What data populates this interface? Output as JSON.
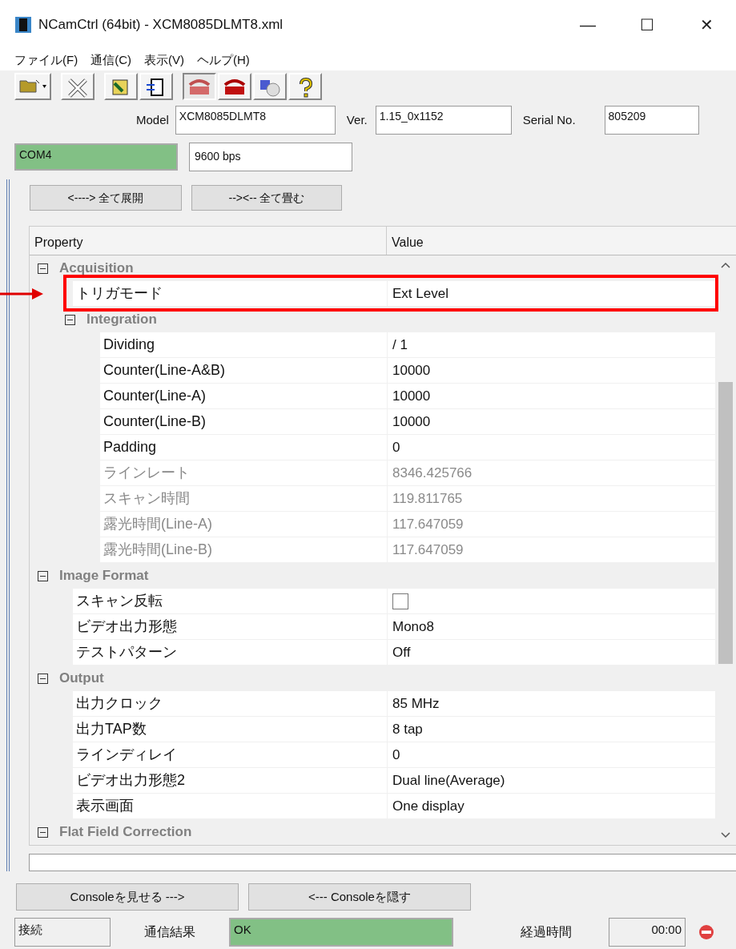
{
  "window": {
    "title": "NCamCtrl (64bit) - XCM8085DLMT8.xml",
    "controls": [
      "—",
      "☐",
      "✕"
    ]
  },
  "menu": [
    "ファイル(F)",
    "通信(C)",
    "表示(V)",
    "ヘルプ(H)"
  ],
  "toolbar": [
    {
      "pressed": false
    },
    {
      "pressed": false
    },
    {
      "pressed": false
    },
    {
      "pressed": false
    },
    {
      "pressed": true
    },
    {
      "pressed": false
    },
    {
      "pressed": false
    },
    {
      "pressed": false
    }
  ],
  "info": [
    {
      "label": "Model",
      "value": "XCM8085DLMT8"
    },
    {
      "label": "Ver.",
      "value": "1.15_0x1152"
    },
    {
      "label": "Serial No.",
      "value": "805209"
    }
  ],
  "port": {
    "value": "COM4",
    "connected": true
  },
  "baud": {
    "value": "9600 bps"
  },
  "expand_buttons": [
    "<----> 全て展開",
    "--><-- 全て畳む"
  ],
  "grid": {
    "columns": [
      "Property",
      "Value"
    ],
    "rows": [
      {
        "kind": "category",
        "label": "Acquisition",
        "expanded": true,
        "children": [
          {
            "kind": "property",
            "label": "トリガモード",
            "value": "Ext Level",
            "readonly": false,
            "highlighted": true
          },
          {
            "kind": "category",
            "label": "Integration",
            "expanded": true,
            "children": [
              {
                "kind": "property",
                "label": "Dividing",
                "value": "/ 1",
                "readonly": false,
                "highlighted": false
              },
              {
                "kind": "property",
                "label": "Counter(Line-A&B)",
                "value": "10000",
                "readonly": false,
                "highlighted": false
              },
              {
                "kind": "property",
                "label": "Counter(Line-A)",
                "value": "10000",
                "readonly": false,
                "highlighted": false
              },
              {
                "kind": "property",
                "label": "Counter(Line-B)",
                "value": "10000",
                "readonly": false,
                "highlighted": false
              },
              {
                "kind": "property",
                "label": "Padding",
                "value": "0",
                "readonly": false,
                "highlighted": false
              },
              {
                "kind": "property",
                "label": "ラインレート",
                "value": "8346.425766",
                "readonly": true,
                "highlighted": false
              },
              {
                "kind": "property",
                "label": "スキャン時間",
                "value": "119.811765",
                "readonly": true,
                "highlighted": false
              },
              {
                "kind": "property",
                "label": "露光時間(Line-A)",
                "value": "117.647059",
                "readonly": true,
                "highlighted": false
              },
              {
                "kind": "property",
                "label": "露光時間(Line-B)",
                "value": "117.647059",
                "readonly": true,
                "highlighted": false
              }
            ]
          }
        ]
      },
      {
        "kind": "category",
        "label": "Image Format",
        "expanded": true,
        "children": [
          {
            "kind": "checkbox",
            "label": "スキャン反転",
            "checked": false,
            "highlighted": false
          },
          {
            "kind": "property",
            "label": "ビデオ出力形態",
            "value": "Mono8",
            "readonly": false,
            "highlighted": false
          },
          {
            "kind": "property",
            "label": "テストパターン",
            "value": "Off",
            "readonly": false,
            "highlighted": false
          }
        ]
      },
      {
        "kind": "category",
        "label": "Output",
        "expanded": true,
        "children": [
          {
            "kind": "property",
            "label": "出力クロック",
            "value": "85 MHz",
            "readonly": false,
            "highlighted": false
          },
          {
            "kind": "property",
            "label": "出力TAP数",
            "value": "8 tap",
            "readonly": false,
            "highlighted": false
          },
          {
            "kind": "property",
            "label": "ラインディレイ",
            "value": "0",
            "readonly": false,
            "highlighted": false
          },
          {
            "kind": "property",
            "label": "ビデオ出力形態2",
            "value": "Dual line(Average)",
            "readonly": false,
            "highlighted": false
          },
          {
            "kind": "property",
            "label": "表示画面",
            "value": "One display",
            "readonly": false,
            "highlighted": false
          }
        ]
      },
      {
        "kind": "category",
        "label": "Flat Field Correction",
        "expanded": true
      }
    ]
  },
  "console_buttons": [
    "Consoleを見せる --->",
    "<--- Consoleを隠す"
  ],
  "status": {
    "connection": "接続",
    "result_label": "通信結果",
    "result": "OK",
    "result_ok": true,
    "elapsed_label": "経過時間",
    "elapsed": "00:00"
  }
}
